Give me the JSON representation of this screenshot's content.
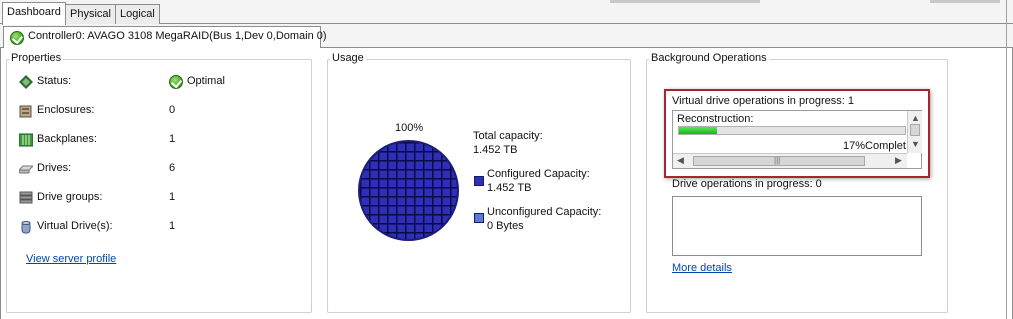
{
  "tabs": [
    {
      "label": "Dashboard",
      "active": true
    },
    {
      "label": "Physical",
      "active": false
    },
    {
      "label": "Logical",
      "active": false
    }
  ],
  "controller_tab": {
    "label": "Controller0: AVAGO 3108 MegaRAID(Bus 1,Dev 0,Domain 0)",
    "icon": "ok-check-icon"
  },
  "properties": {
    "title": "Properties",
    "rows": [
      {
        "label": "Status:",
        "value": "Optimal",
        "icon": "status-diamond-icon"
      },
      {
        "label": "Enclosures:",
        "value": "0",
        "icon": "enclosure-icon"
      },
      {
        "label": "Backplanes:",
        "value": "1",
        "icon": "backplane-icon"
      },
      {
        "label": "Drives:",
        "value": "6",
        "icon": "drive-icon"
      },
      {
        "label": "Drive groups:",
        "value": "1",
        "icon": "drive-group-icon"
      },
      {
        "label": "Virtual Drive(s):",
        "value": "1",
        "icon": "virtual-drive-icon"
      }
    ],
    "link": "View server profile"
  },
  "usage": {
    "title": "Usage",
    "pie_percent_label": "100%",
    "total_label": "Total capacity:",
    "total_value": "1.452 TB",
    "configured_label": "Configured Capacity:",
    "configured_value": "1.452 TB",
    "unconfigured_label": "Unconfigured Capacity:",
    "unconfigured_value": "0 Bytes",
    "colors": {
      "configured": "#2e2eb7"
    }
  },
  "background_ops": {
    "title": "Background Operations",
    "vd_ops_label": "Virtual drive operations in progress: 1",
    "operation_name": "Reconstruction:",
    "progress_fraction": 0.17,
    "progress_text": "17%Complet",
    "drive_ops_label": "Drive operations in progress: 0",
    "more_details": "More details",
    "highlight_color": "#a5262b"
  }
}
